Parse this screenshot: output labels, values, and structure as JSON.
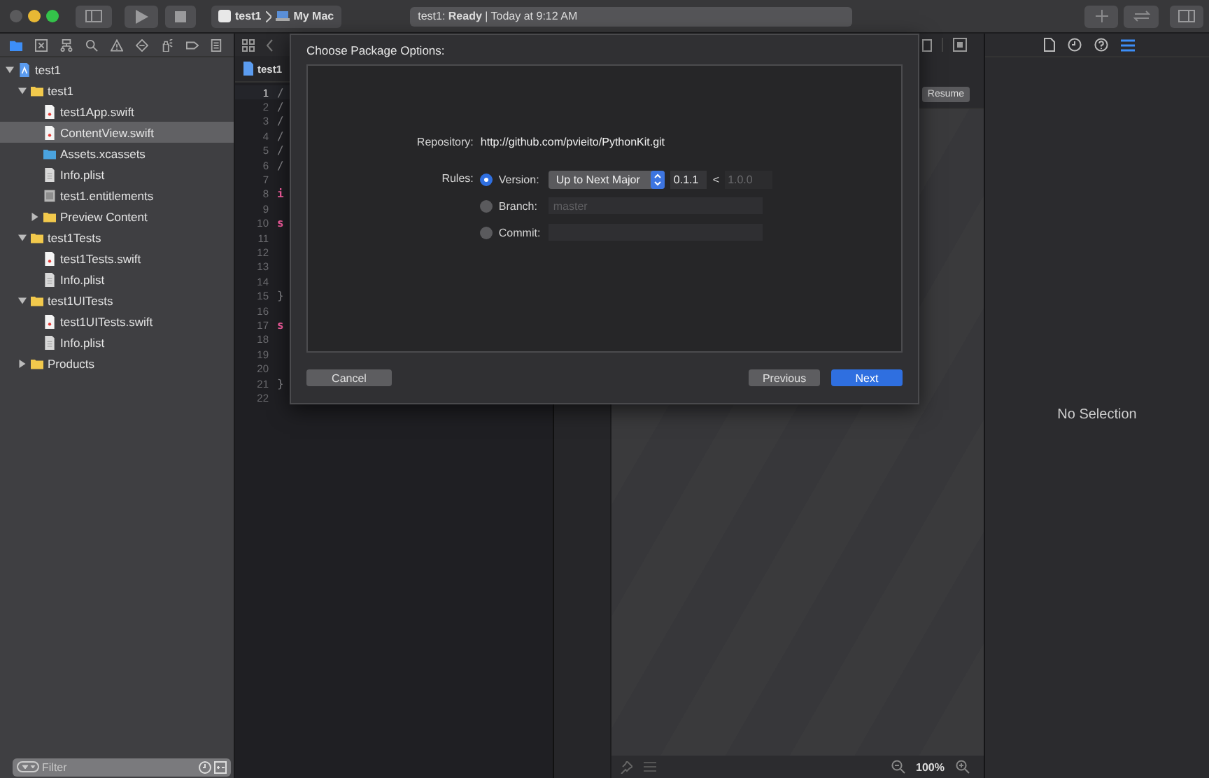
{
  "toolbar": {
    "scheme": {
      "project": "test1",
      "destination": "My Mac"
    },
    "status": "test1: **Ready** | Today at 9:12 AM"
  },
  "navigator": {
    "tree": [
      {
        "label": "test1",
        "kind": "project",
        "expanded": true,
        "selected": false,
        "children": [
          {
            "label": "test1",
            "kind": "folder",
            "expanded": true,
            "selected": false,
            "children": [
              {
                "label": "test1App.swift",
                "kind": "swift",
                "selected": false
              },
              {
                "label": "ContentView.swift",
                "kind": "swift",
                "selected": true
              },
              {
                "label": "Assets.xcassets",
                "kind": "assets",
                "selected": false
              },
              {
                "label": "Info.plist",
                "kind": "plist",
                "selected": false
              },
              {
                "label": "test1.entitlements",
                "kind": "entitlements",
                "selected": false
              },
              {
                "label": "Preview Content",
                "kind": "folder",
                "expanded": false,
                "selected": false
              }
            ]
          },
          {
            "label": "test1Tests",
            "kind": "folder",
            "expanded": true,
            "selected": false,
            "children": [
              {
                "label": "test1Tests.swift",
                "kind": "swift",
                "selected": false
              },
              {
                "label": "Info.plist",
                "kind": "plist",
                "selected": false
              }
            ]
          },
          {
            "label": "test1UITests",
            "kind": "folder",
            "expanded": true,
            "selected": false,
            "children": [
              {
                "label": "test1UITests.swift",
                "kind": "swift",
                "selected": false
              },
              {
                "label": "Info.plist",
                "kind": "plist",
                "selected": false
              }
            ]
          },
          {
            "label": "Products",
            "kind": "folder",
            "expanded": false,
            "selected": false
          }
        ]
      }
    ],
    "filter": {
      "placeholder": "Filter"
    }
  },
  "editor": {
    "breadcrumb": "test1",
    "lines": [
      {
        "number": "1",
        "code": "/",
        "current": true
      },
      {
        "number": "2",
        "code": "/",
        "current": false
      },
      {
        "number": "3",
        "code": "/",
        "current": false
      },
      {
        "number": "4",
        "code": "/",
        "current": false
      },
      {
        "number": "5",
        "code": "/",
        "current": false
      },
      {
        "number": "6",
        "code": "/",
        "current": false
      },
      {
        "number": "7",
        "current": false
      },
      {
        "number": "8",
        "code": "i",
        "current": false
      },
      {
        "number": "9",
        "current": false
      },
      {
        "number": "10",
        "code": "s",
        "current": false
      },
      {
        "number": "11",
        "current": false
      },
      {
        "number": "12",
        "current": false
      },
      {
        "number": "13",
        "current": false
      },
      {
        "number": "14",
        "current": false
      },
      {
        "number": "15",
        "code": "}",
        "current": false
      },
      {
        "number": "16",
        "current": false
      },
      {
        "number": "17",
        "code": "s",
        "current": false
      },
      {
        "number": "18",
        "current": false
      },
      {
        "number": "19",
        "current": false
      },
      {
        "number": "20",
        "current": false
      },
      {
        "number": "21",
        "code": "}",
        "current": false
      },
      {
        "number": "22",
        "current": false
      }
    ]
  },
  "canvas": {
    "resume": "Resume",
    "zoom": "100%"
  },
  "inspector": {
    "empty_message": "No Selection"
  },
  "sheet": {
    "title": "Choose Package Options:",
    "repository_label": "Repository:",
    "repository_url": "http://github.com/pvieito/PythonKit.git",
    "rules_label": "Rules:",
    "rules": [
      {
        "kind": "version",
        "label": "Version:",
        "selected": true,
        "rule": "Up to Next Major",
        "from": "0.1.1",
        "separator": "<",
        "to": "1.0.0"
      },
      {
        "kind": "branch",
        "label": "Branch:",
        "selected": false,
        "placeholder": "master"
      },
      {
        "kind": "commit",
        "label": "Commit:",
        "selected": false
      }
    ],
    "buttons": [
      {
        "label": "Cancel",
        "kind": "secondary"
      },
      {
        "label": "Previous",
        "kind": "secondary"
      },
      {
        "label": "Next",
        "kind": "primary"
      }
    ]
  }
}
